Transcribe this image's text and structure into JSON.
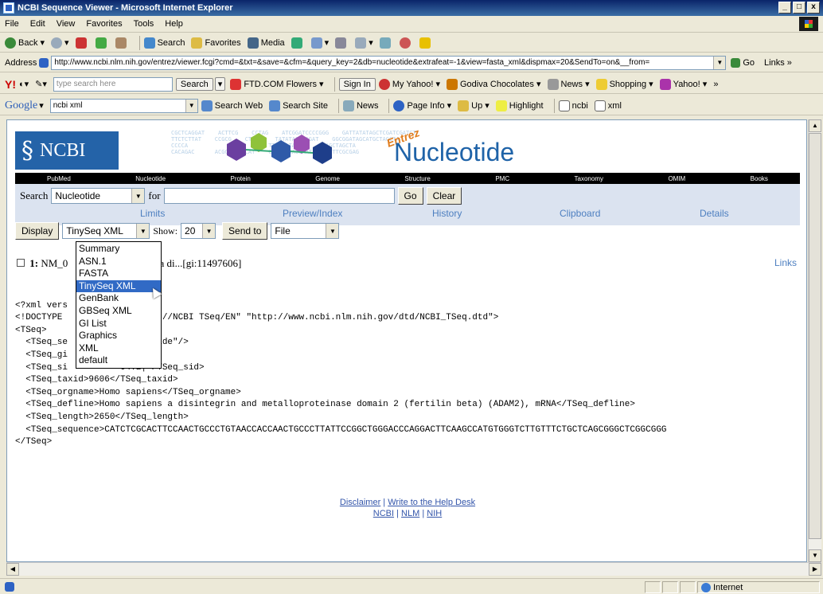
{
  "window": {
    "title": "NCBI Sequence Viewer - Microsoft Internet Explorer",
    "controls": [
      "_",
      "□",
      "x"
    ]
  },
  "menu": [
    "File",
    "Edit",
    "View",
    "Favorites",
    "Tools",
    "Help"
  ],
  "toolbar": {
    "back": "Back",
    "search": "Search",
    "favorites": "Favorites",
    "media": "Media"
  },
  "address": {
    "label": "Address",
    "url": "http://www.ncbi.nlm.nih.gov/entrez/viewer.fcgi?cmd=&txt=&save=&cfm=&query_key=2&db=nucleotide&extrafeat=-1&view=fasta_xml&dispmax=20&SendTo=on&__from=",
    "go": "Go",
    "links": "Links »"
  },
  "yahoo": {
    "search_placeholder": "type search here",
    "search_button": "Search",
    "ftd": "FTD.COM Flowers",
    "signin": "Sign In",
    "myyahoo": "My Yahoo!",
    "godiva": "Godiva Chocolates",
    "news": "News",
    "shopping": "Shopping",
    "yahoo": "Yahoo!",
    "more": "»"
  },
  "google": {
    "logo": "Google",
    "query": "ncbi xml",
    "search_web": "Search Web",
    "search_site": "Search Site",
    "news": "News",
    "page_info": "Page Info",
    "up": "Up",
    "highlight": "Highlight",
    "ncbi": "ncbi",
    "xml": "xml"
  },
  "page": {
    "logo": "NCBI",
    "title": "Nucleotide",
    "entrez": "Entrez",
    "dna": "CGCTCAGGAT    ACTTCG    CCTAG    ATCGGATCCCCGGG    GATTATATAGCTCGATCGATCT\nTTCTCTTAT    CCGCG    CTAGG    TATATACACAGAT    GGCGGATAGCATGCTAGCTA\nCCCCA                        TTCGCATACGTC    TAGCTAGCTA\nCACAGAC      ACGC    TCAT    CTTACTAACCAAT    ACTTCGCGAG",
    "nav": [
      "PubMed",
      "Nucleotide",
      "Protein",
      "Genome",
      "Structure",
      "PMC",
      "Taxonomy",
      "OMIM",
      "Books"
    ],
    "search_label": "Search",
    "db": "Nucleotide",
    "for_label": "for",
    "go": "Go",
    "clear": "Clear",
    "tabs": [
      "Limits",
      "Preview/Index",
      "History",
      "Clipboard",
      "Details"
    ],
    "display": "Display",
    "format": "TinySeq XML",
    "show_label": "Show:",
    "show_value": "20",
    "send_to": "Send to",
    "file": "File",
    "result_prefix": "1:",
    "result_accession": "NM_0",
    "result_text": "piens a di...[gi:11497606]",
    "links": "Links",
    "xml_lines": [
      "<?xml vers",
      "<!DOCTYPE            -//NCBI//NCBI TSeq/EN\" \"http://www.ncbi.nlm.nih.gov/dtd/NCBI_TSeq.dtd\">",
      "<TSeq>",
      "  <TSeq_se          nucleotide\"/>",
      "  <TSeq_gi          eq_gi>",
      "  <TSeq_si          64.2|</TSeq_sid>",
      "  <TSeq_taxid>9606</TSeq_taxid>",
      "  <TSeq_orgname>Homo sapiens</TSeq_orgname>",
      "  <TSeq_defline>Homo sapiens a disintegrin and metalloproteinase domain 2 (fertilin beta) (ADAM2), mRNA</TSeq_defline>",
      "  <TSeq_length>2650</TSeq_length>",
      "  <TSeq_sequence>CATCTCGCACTTCCAACTGCCCTGTAACCACCAACTGCCCTTATTCCGGCTGGGACCCAGGACTTCAAGCCATGTGGGTCTTGTTTCTGCTCAGCGGGCTCGGCGGG",
      "</TSeq>"
    ],
    "dropdown": [
      "Summary",
      "ASN.1",
      "FASTA",
      "TinySeq XML",
      "GenBank",
      "GBSeq XML",
      "GI List",
      "Graphics",
      "XML",
      "default"
    ],
    "selected_index": 3,
    "footer": {
      "disclaimer": "Disclaimer",
      "sep": " | ",
      "help": "Write to the Help Desk",
      "ncbi": "NCBI",
      "nlm": "NLM",
      "nih": "NIH"
    }
  },
  "status": {
    "zone": "Internet"
  }
}
